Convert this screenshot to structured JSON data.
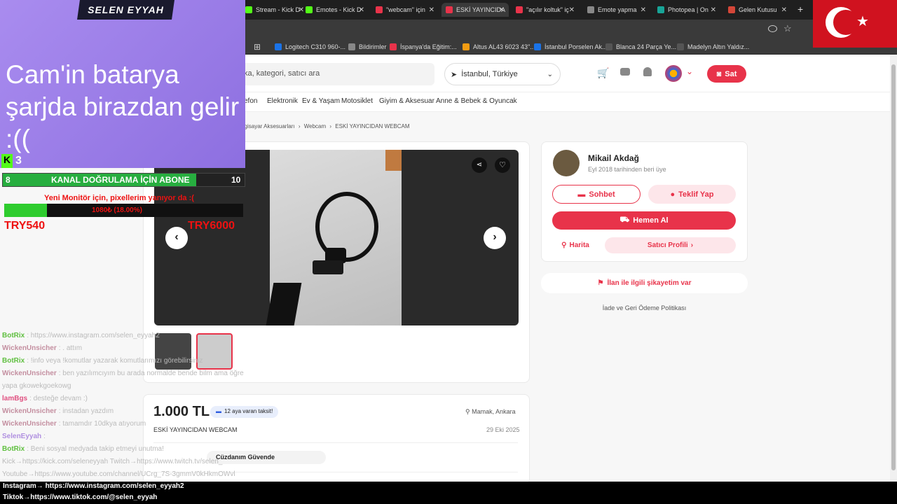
{
  "browser": {
    "tabs": [
      {
        "title": "Stream - Kick D",
        "color": "#53fc18",
        "icon": "kick-icon",
        "active": false
      },
      {
        "title": "Emotes - Kick D",
        "color": "#53fc18",
        "icon": "kick-icon",
        "active": false
      },
      {
        "title": "\"webcam\" için",
        "color": "#e8334a",
        "icon": "letgo-icon",
        "active": false
      },
      {
        "title": "ESKİ YAYINCIDA",
        "color": "#e8334a",
        "icon": "letgo-icon",
        "active": true
      },
      {
        "title": "\"açılır koltuk\" iç",
        "color": "#e8334a",
        "icon": "letgo-icon",
        "active": false
      },
      {
        "title": "Emote yapma",
        "color": "#888888",
        "icon": "globe-icon",
        "active": false
      },
      {
        "title": "Photopea | On",
        "color": "#18a497",
        "icon": "photopea-icon",
        "active": false
      },
      {
        "title": "Gelen Kutusu",
        "color": "#d44638",
        "icon": "gmail-icon",
        "active": false
      }
    ],
    "new_tab": "+",
    "bookmarks": [
      {
        "label": "Logitech C310 960-...",
        "color": "#1a73e8"
      },
      {
        "label": "Bildirimler",
        "color": "#888888"
      },
      {
        "label": "İspanya'da Eğitim:...",
        "color": "#e8334a"
      },
      {
        "label": "Altus AL43 6023 43\"...",
        "color": "#f39c12"
      },
      {
        "label": "İstanbul Porselen Ak...",
        "color": "#1a73e8"
      },
      {
        "label": "Blanca 24 Parça Ye...",
        "color": "#555555"
      },
      {
        "label": "Madelyn Altın Yaldız...",
        "color": "#555555"
      }
    ]
  },
  "site": {
    "search_placeholder": "ka, kategori, satıcı ara",
    "location": "İstanbul, Türkiye",
    "sell_label": "Sat",
    "categories": [
      "efon",
      "Elektronik",
      "Ev & Yaşam",
      "Motosiklet",
      "Giyim & Aksesuar",
      "Anne & Bebek & Oyuncak"
    ],
    "breadcrumbs": [
      "ilgisayar Aksesuarları",
      "Webcam",
      "ESKİ YAYINCIDAN WEBCAM"
    ],
    "seller": {
      "name": "Mikail Akdağ",
      "since": "Eyl 2018 tarihinden beri üye",
      "chat": "Sohbet",
      "offer": "Teklif Yap",
      "buy": "Hemen Al",
      "map": "Harita",
      "profile": "Satıcı Profili"
    },
    "report": "İlan ile ilgili şikayetim var",
    "refund": "İade ve Geri Ödeme Politikası",
    "listing": {
      "price": "1.000 TL",
      "installment": "12 aya varan taksit!",
      "location": "Mamak, Ankara",
      "title": "ESKİ YAYINCIDAN WEBCAM",
      "date": "29 Eki 2025",
      "wallet": "Cüzdanım Güvende"
    }
  },
  "overlay": {
    "name": "SELEN EYYAH",
    "message": "Cam'in batarya şarjda birazdan gelir :((",
    "kick_count": "3",
    "goal_left": "8",
    "goal_label": "KANAL DOĞRULAMA İÇİN ABONE",
    "goal_right": "10",
    "goal_progress": 0.8,
    "monitor_text": "Yeni Monitör için, pixellerim yanıyor da :(",
    "monitor_progress_label": "1080₺ (18.00%)",
    "monitor_progress": 0.18,
    "current": "TRY540",
    "target": "TRY6000",
    "chat": [
      {
        "user": "BotRix",
        "text": ": https://www.instagram.com/selen_eyyah2",
        "color": "#5fbf3f"
      },
      {
        "user": "WickenUnsicher",
        "text": ": . attım",
        "color": "#c48fa0"
      },
      {
        "user": "BotRix",
        "text": ": !info veya !komutlar yazarak komutlarımızı görebilirsiniz",
        "color": "#5fbf3f"
      },
      {
        "user": "WickenUnsicher",
        "text": ": ben yazılımcıyım bu arada normalde bende bilm ama öğre yapa gkowekgoekowg",
        "color": "#c48fa0"
      },
      {
        "user": "lamBgs",
        "text": ": desteğe devam :)",
        "color": "#e05080"
      },
      {
        "user": "WickenUnsicher",
        "text": ": instadan yazdım",
        "color": "#c48fa0"
      },
      {
        "user": "WickenUnsicher",
        "text": ": tamamdır 10dkya atıyorum",
        "color": "#c48fa0"
      },
      {
        "user": "SelenEyyah",
        "text": ":",
        "color": "#b090e0"
      },
      {
        "user": "BotRix",
        "text": ": Beni sosyal medyada takip etmeyi unutma! Kick→https://kick.com/seleneyyah Twitch→https://www.twitch.tv/selen_ Youtube→https://www.youtube.com/channel/UCrg_7S-3gmmV0kHkmOWvl",
        "color": "#5fbf3f"
      }
    ],
    "social_instagram": "Instagram→ https://www.instagram.com/selen_eyyah2",
    "social_tiktok": "Tiktok→https://www.tiktok.com/@selen_eyyah"
  }
}
